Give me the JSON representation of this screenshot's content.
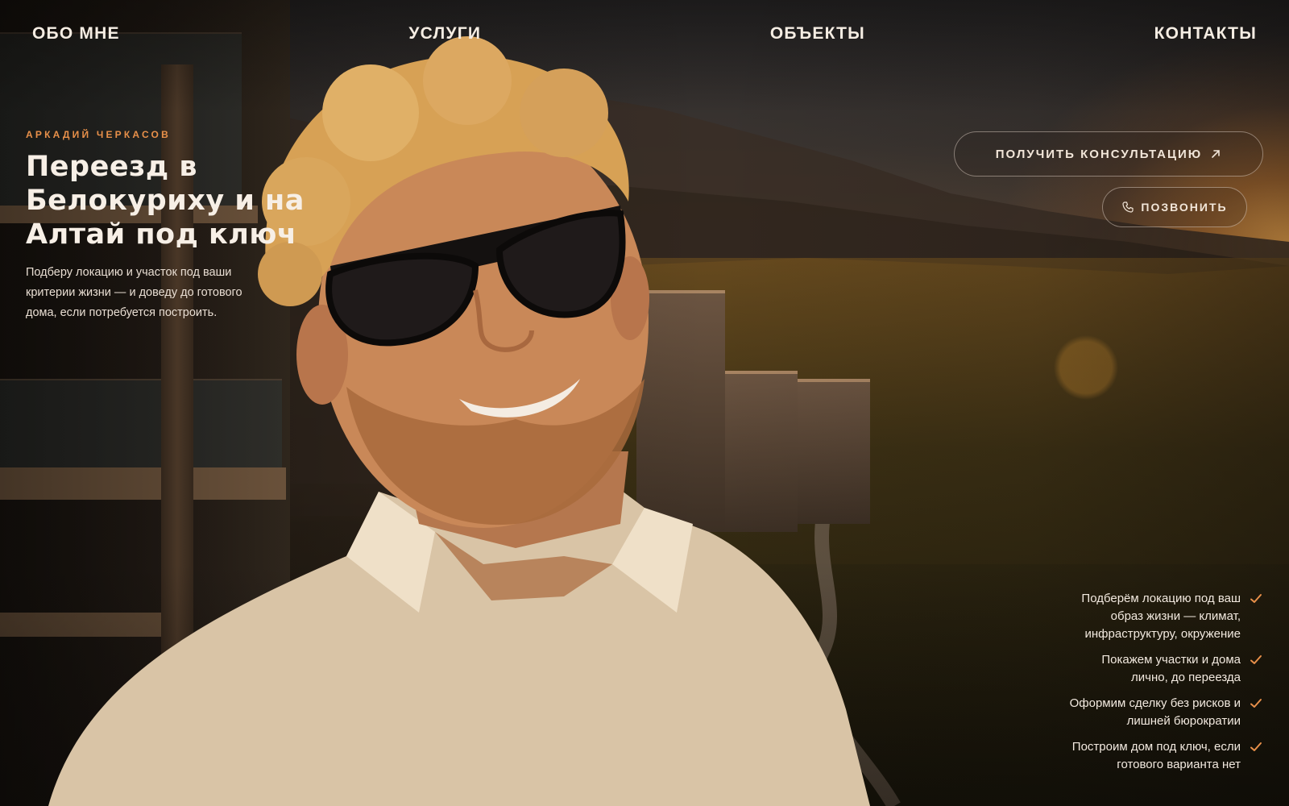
{
  "nav": {
    "items": [
      {
        "label": "ОБО МНЕ",
        "name": "nav-about"
      },
      {
        "label": "УСЛУГИ",
        "name": "nav-services"
      },
      {
        "label": "ОБЪЕКТЫ",
        "name": "nav-objects"
      },
      {
        "label": "КОНТАКТЫ",
        "name": "nav-contacts"
      }
    ]
  },
  "hero": {
    "eyebrow": "АРКАДИЙ ЧЕРКАСОВ",
    "title_lines": [
      "Переезд в",
      "Белокуриху и на",
      "Алтай под ключ"
    ],
    "lead": "Подберу локацию и участок под ваши критерии жизни — и доведу до готового дома, если потребуется построить."
  },
  "cta": {
    "consult_label": "ПОЛУЧИТЬ КОНСУЛЬТАЦИЮ",
    "consult_icon": "arrow-up-right-icon",
    "call_label": "ПОЗВОНИТЬ",
    "call_icon": "phone-icon"
  },
  "benefits": [
    {
      "lines": [
        "Подберём локацию под ваш",
        "образ жизни — климат,",
        "инфраструктуру, окружение"
      ]
    },
    {
      "lines": [
        "Покажем участки и дома",
        "лично, до переезда"
      ]
    },
    {
      "lines": [
        "Оформим сделку без рисков и",
        "лишней бюрократии"
      ]
    },
    {
      "lines": [
        "Построим дом под ключ, если",
        "готового варианта нет"
      ]
    }
  ],
  "colors": {
    "accent": "#e8904a",
    "text": "#f5ede3",
    "check": "#e8904a"
  }
}
